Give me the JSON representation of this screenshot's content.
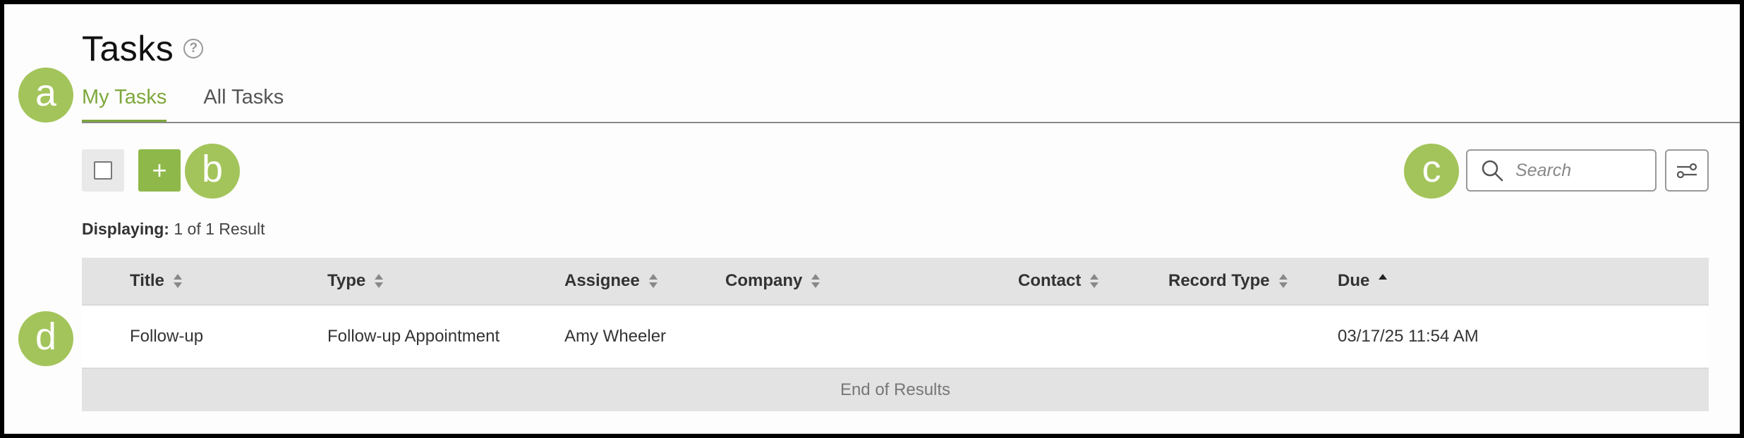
{
  "page": {
    "title": "Tasks",
    "help_icon": "?"
  },
  "tabs": [
    {
      "label": "My Tasks",
      "active": true
    },
    {
      "label": "All Tasks",
      "active": false
    }
  ],
  "toolbar": {
    "add_label": "+",
    "search_placeholder": "Search"
  },
  "callouts": {
    "a": "a",
    "b": "b",
    "c": "c",
    "d": "d"
  },
  "results": {
    "label": "Displaying:",
    "value": "1 of 1 Result"
  },
  "table": {
    "columns": [
      "Title",
      "Type",
      "Assignee",
      "Company",
      "Contact",
      "Record Type",
      "Due"
    ],
    "rows": [
      {
        "title": "Follow-up",
        "type": "Follow-up Appointment",
        "assignee": "Amy Wheeler",
        "company": "",
        "contact": "",
        "record_type": "",
        "due": "03/17/25 11:54 AM"
      }
    ],
    "footer": "End of Results"
  },
  "colors": {
    "accent": "#7ea83b",
    "badge": "#a3c45a",
    "add_button": "#8fb84a"
  }
}
